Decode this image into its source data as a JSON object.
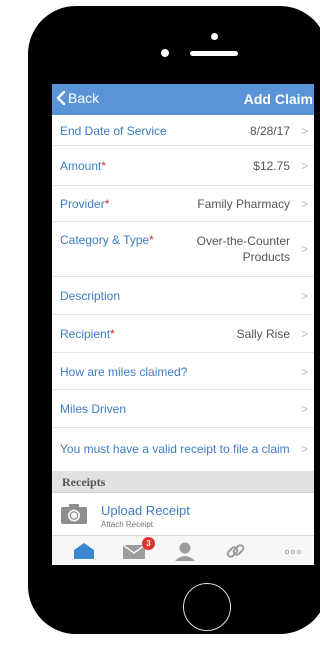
{
  "nav": {
    "back_label": "Back",
    "title": "Add Claim"
  },
  "rows": [
    {
      "label": "End Date of Service",
      "required": "",
      "value": "8/28/17"
    },
    {
      "label": "Amount",
      "required": "*",
      "value": "$12.75"
    },
    {
      "label": "Provider",
      "required": "*",
      "value": "Family Pharmacy"
    },
    {
      "label": "Category & Type",
      "required": "*",
      "value_line1": "Over-the-Counter",
      "value_line2": "Products"
    },
    {
      "label": "Description",
      "required": "",
      "value": ""
    },
    {
      "label": "Recipient",
      "required": "*",
      "value": "Sally Rise"
    },
    {
      "label": "How are miles claimed?",
      "required": "",
      "value": ""
    },
    {
      "label": "Miles Driven",
      "required": "",
      "value": ""
    },
    {
      "label": "You must have a valid receipt to file a claim",
      "required": "",
      "value": ""
    }
  ],
  "chevron": ">",
  "receipts": {
    "header": "Receipts",
    "upload_title": "Upload Receipt",
    "upload_sub": "Attach Receipt"
  },
  "tabbar": {
    "messages_badge": "3"
  },
  "colors": {
    "nav_bg": "#5a94d6",
    "label_blue": "#3e7cc5",
    "required_red": "#d0302f",
    "badge_red": "#e0322c"
  }
}
